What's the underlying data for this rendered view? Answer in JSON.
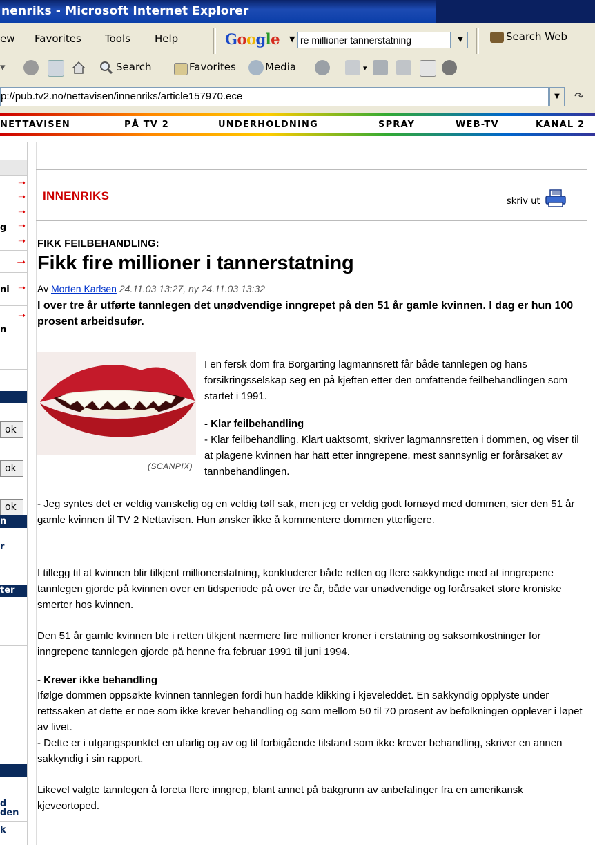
{
  "window": {
    "title": "nenriks - Microsoft Internet Explorer"
  },
  "menu": {
    "view": "ew",
    "favorites": "Favorites",
    "tools": "Tools",
    "help": "Help"
  },
  "google_bar": {
    "logo": "Google",
    "query": "re millioner tannerstatning",
    "search_web": "Search Web"
  },
  "toolbar": {
    "search": "Search",
    "favorites": "Favorites",
    "media": "Media"
  },
  "address": {
    "url": "p://pub.tv2.no/nettavisen/innenriks/article157970.ece"
  },
  "site_nav": [
    "NETTAVISEN",
    "PÅ TV 2",
    "UNDERHOLDNING",
    "SPRAY",
    "WEB-TV",
    "KANAL 2"
  ],
  "left_strip": {
    "row_g": "g",
    "row_ni": "ni",
    "row_n1": "n",
    "ok1": "ok",
    "ok2": "ok",
    "ok3": "ok",
    "row_n2": "n",
    "row_r": "r",
    "row_ter": "ter",
    "row_d": "d",
    "row_den": "den",
    "row_k": "k"
  },
  "article": {
    "section": "INNENRIKS",
    "print": "skriv ut",
    "kicker": "FIKK FEILBEHANDLING:",
    "headline": "Fikk fire millioner i tannerstatning",
    "byline_prefix": "Av",
    "author": "Morten Karlsen",
    "timestamp": "24.11.03 13:27, ny 24.11.03 13:32",
    "lead": "I over tre år utførte tannlegen det unødvendige inngrepet på den 51 år gamle kvinnen. I dag er hun 100 prosent arbeidsufør.",
    "photo_credit": "(SCANPIX)",
    "p1": "I en fersk dom fra Borgarting lagmannsrett får både tannlegen og hans forsikringsselskap seg en på kjeften etter den omfattende feilbehandlingen som startet i 1991.",
    "sub1": "- Klar feilbehandling",
    "p2": "- Klar feilbehandling. Klart uaktsomt, skriver lagmannsretten i dommen, og viser til at plagene kvinnen har hatt etter inngrepene, mest sannsynlig er forårsaket av tannbehandlingen.",
    "p3": "- Jeg syntes det er veldig vanskelig og en veldig tøff sak, men jeg er veldig godt fornøyd med dommen, sier den 51 år gamle kvinnen til TV 2 Nettavisen. Hun ønsker ikke å kommentere dommen ytterligere.",
    "p4": "I tillegg til at kvinnen blir tilkjent millionerstatning, konkluderer både retten og flere sakkyndige med at inngrepene tannlegen gjorde på kvinnen over en tidsperiode på over tre år, både var unødvendige og forårsaket store kroniske smerter hos kvinnen.",
    "p5": "Den 51 år gamle kvinnen ble i retten tilkjent nærmere fire millioner kroner i erstatning og saksomkostninger for inngrepene tannlegen gjorde på henne fra februar 1991 til juni 1994.",
    "sub2": "- Krever ikke behandling",
    "p6": "Ifølge dommen oppsøkte kvinnen tannlegen fordi hun hadde klikking i kjeveleddet. En sakkyndig opplyste under rettssaken at dette er noe som ikke krever behandling og som mellom 50 til 70 prosent av befolkningen opplever i løpet av livet.",
    "p7": "- Dette er i utgangspunktet en ufarlig og av og til forbigående tilstand som ikke krever behandling, skriver en annen sakkyndig i sin rapport.",
    "p8": "Likevel valgte tannlegen å foreta flere inngrep, blant annet på bakgrunn av anbefalinger fra en amerikansk kjeveortoped."
  }
}
